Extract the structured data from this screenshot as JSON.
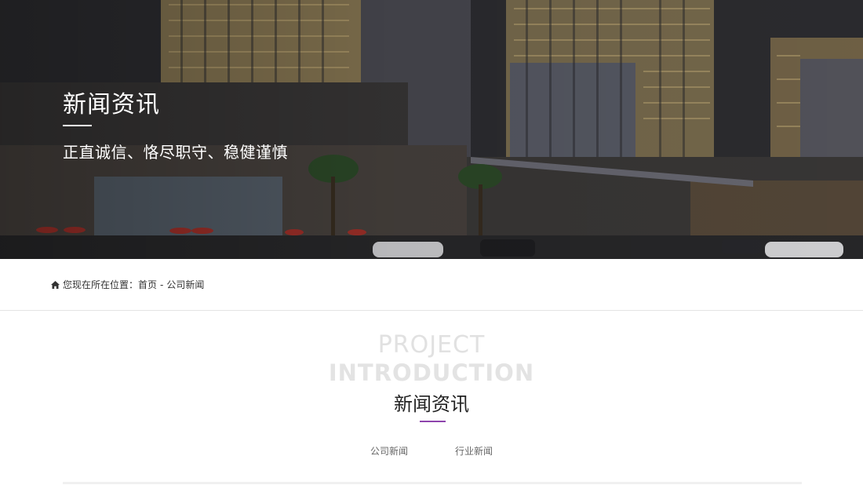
{
  "banner": {
    "title": "新闻资讯",
    "subtitle": "正直诚信、恪尽职守、稳健谨慎"
  },
  "breadcrumb": {
    "prefix": "您现在所在位置：",
    "home": "首页",
    "separator": "-",
    "current": "公司新闻"
  },
  "section": {
    "title_en_line1": "PROJECT",
    "title_en_line2": "INTRODUCTION",
    "title_cn": "新闻资讯",
    "accent_color": "#8e44ad"
  },
  "tabs": [
    {
      "label": "公司新闻"
    },
    {
      "label": "行业新闻"
    }
  ],
  "icons": {
    "breadcrumb": "home-icon"
  }
}
